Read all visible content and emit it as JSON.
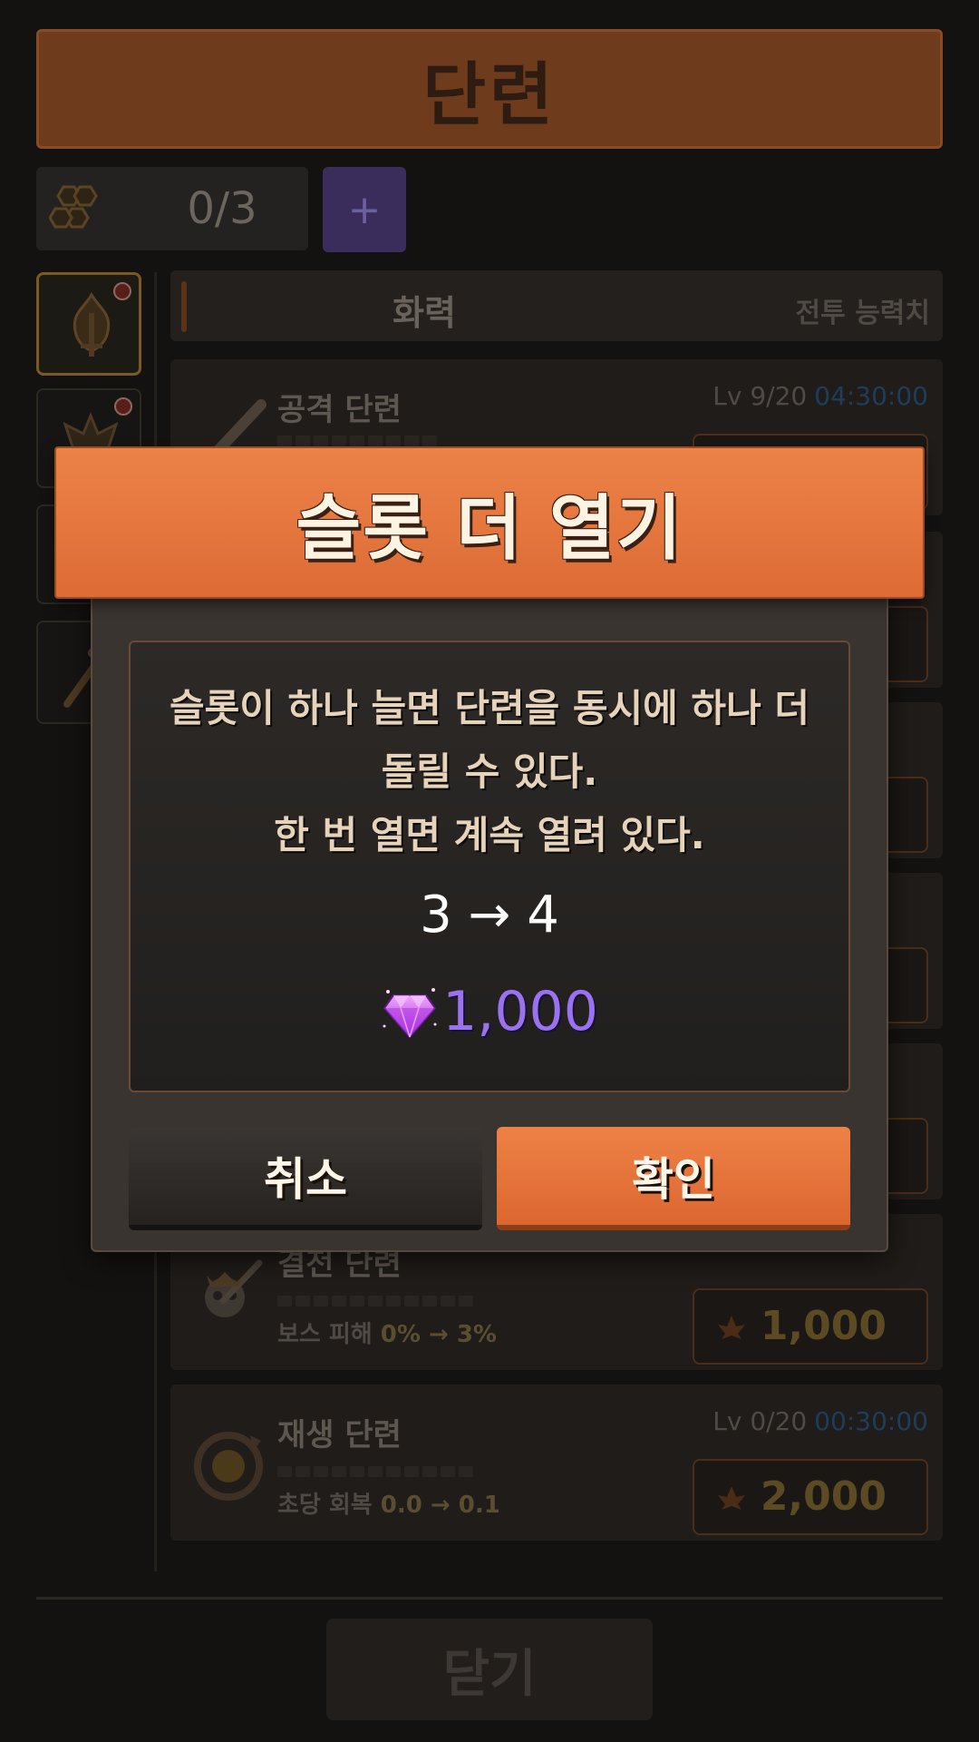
{
  "page": {
    "title": "단련",
    "slots": {
      "count": "0/3",
      "add_label": "+"
    },
    "category": {
      "name": "화력",
      "subtitle": "전투 능력치"
    },
    "side_tabs": [
      {
        "icon": "flame-sword-icon",
        "active": true,
        "alert": true
      },
      {
        "icon": "winged-crest-icon",
        "active": false,
        "alert": true
      },
      {
        "icon": "shield-icon",
        "active": false,
        "alert": false
      },
      {
        "icon": "hammer-icon",
        "active": false,
        "alert": false
      }
    ],
    "cards": [
      {
        "icon": "sword-icon",
        "name": "공격 단련",
        "level": "Lv 9/20",
        "time": "04:30:00",
        "effect_label": "",
        "effect_value": "",
        "cost": ""
      },
      {
        "icon": "skull-sword-icon",
        "name": "결전 단련",
        "level": "",
        "time": "",
        "effect_label": "보스 피해",
        "effect_value": "0% → 3%",
        "cost": "1,000"
      },
      {
        "icon": "regen-icon",
        "name": "재생 단련",
        "level": "Lv 0/20",
        "time": "00:30:00",
        "effect_label": "초당 회복",
        "effect_value": "0.0 → 0.1",
        "cost": "2,000"
      }
    ],
    "close_label": "닫기"
  },
  "modal": {
    "title": "슬롯 더 열기",
    "description_lines": [
      "슬롯이 하나 늘면 단련을 동시에 하나 더",
      "돌릴 수 있다.",
      "한 번 열면 계속 열려 있다."
    ],
    "change": "3 → 4",
    "price": {
      "currency_icon": "gem-icon",
      "amount": "1,000"
    },
    "cancel_label": "취소",
    "confirm_label": "확인"
  },
  "colors": {
    "accent_orange": "#e5753d",
    "gem_purple": "#9a72f0",
    "timer_blue": "#1e3d5c"
  }
}
